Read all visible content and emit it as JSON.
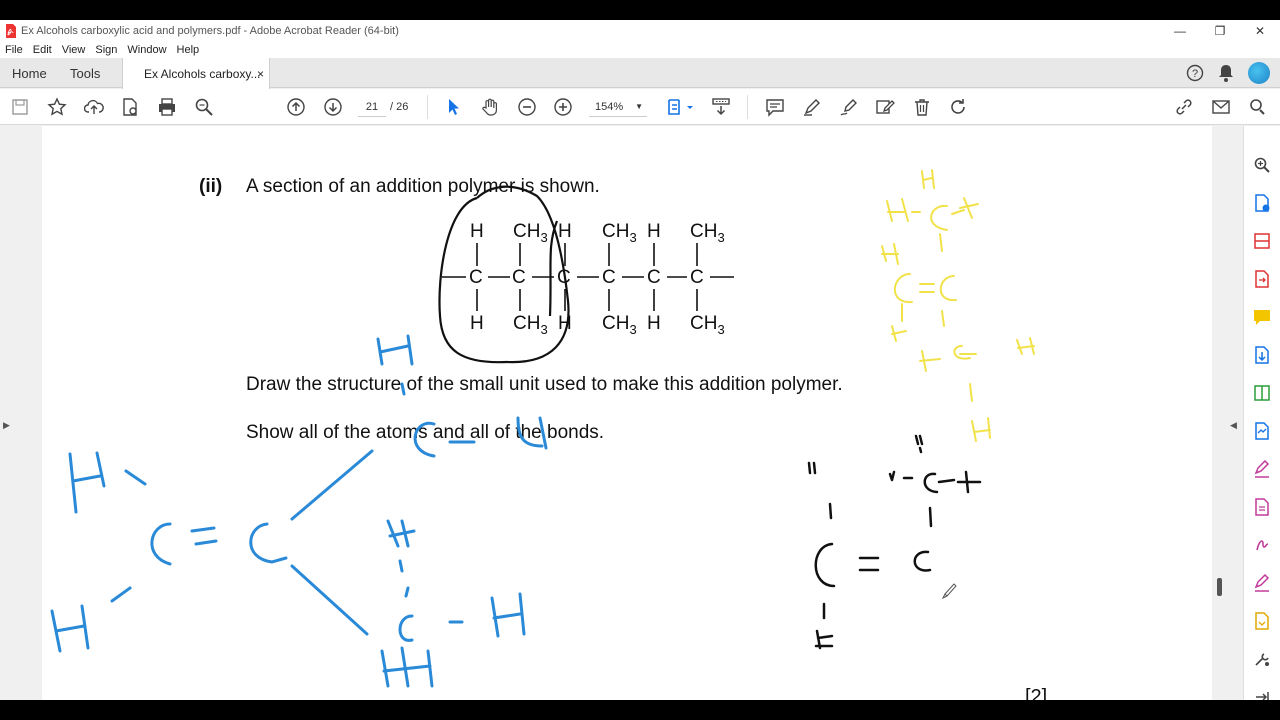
{
  "window": {
    "title": "Ex Alcohols carboxylic acid and polymers.pdf - Adobe Acrobat Reader (64-bit)"
  },
  "menu": [
    "File",
    "Edit",
    "View",
    "Sign",
    "Window",
    "Help"
  ],
  "tabs": {
    "home": "Home",
    "tools": "Tools",
    "doc": "Ex Alcohols carboxy...",
    "close": "×"
  },
  "toolbar": {
    "page_current": "21",
    "page_total": "/ 26",
    "zoom": "154%"
  },
  "question": {
    "part": "(ii)",
    "stem": "A section of an addition polymer is shown.",
    "instruction1": "Draw the structure of the small unit used to make this addition polymer.",
    "instruction2": "Show all of the atoms and all of the bonds.",
    "marks": "[2]"
  },
  "polymer": {
    "top_groups": [
      "H",
      "CH",
      "H",
      "CH",
      "H",
      "CH"
    ],
    "bottom_groups": [
      "H",
      "CH",
      "H",
      "CH",
      "H",
      "CH"
    ],
    "sub": "3",
    "backbone": "C"
  },
  "colors": {
    "accent": "#1473e6",
    "pen_blue": "#2a8ad8",
    "pen_yellow": "#f2e24a",
    "pen_black": "#111111"
  }
}
